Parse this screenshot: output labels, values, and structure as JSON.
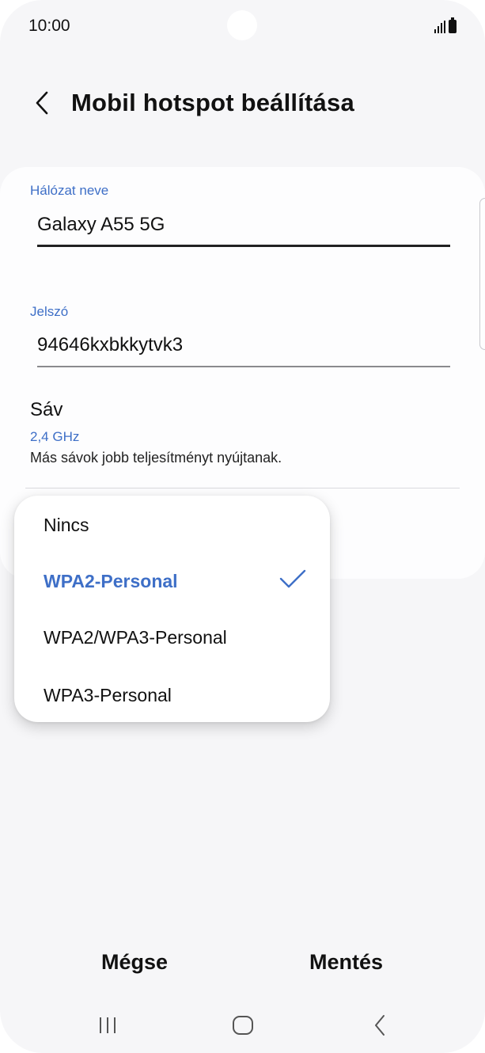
{
  "status_bar": {
    "time": "10:00",
    "icons": [
      "signal-icon",
      "battery-icon"
    ]
  },
  "header": {
    "back_icon": "chevron-left-icon",
    "title": "Mobil hotspot beállítása"
  },
  "form": {
    "network_name": {
      "label": "Hálózat neve",
      "value": "Galaxy A55 5G"
    },
    "password": {
      "label": "Jelszó",
      "value": "94646kxbkkytvk3"
    },
    "band": {
      "title": "Sáv",
      "value": "2,4 GHz",
      "hint": "Más sávok jobb teljesítményt nyújtanak."
    }
  },
  "security_dropdown": {
    "options": [
      {
        "label": "Nincs",
        "selected": false
      },
      {
        "label": "WPA2-Personal",
        "selected": true
      },
      {
        "label": "WPA2/WPA3-Personal",
        "selected": false
      },
      {
        "label": "WPA3-Personal",
        "selected": false
      }
    ],
    "selected_icon": "checkmark-icon"
  },
  "footer": {
    "cancel_label": "Mégse",
    "save_label": "Mentés"
  },
  "nav_bar": {
    "icons": [
      "recent-apps-icon",
      "home-icon",
      "back-icon"
    ]
  },
  "colors": {
    "accent": "#3e6fc7",
    "background": "#f6f6f8",
    "card": "#fdfdfe"
  }
}
